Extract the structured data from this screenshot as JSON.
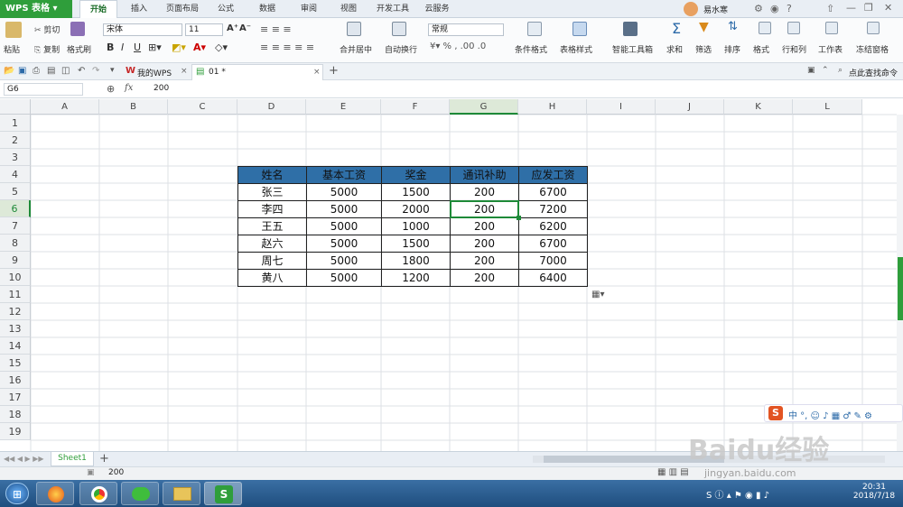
{
  "app": {
    "name": "WPS 表格"
  },
  "menu": {
    "tabs": [
      "开始",
      "插入",
      "页面布局",
      "公式",
      "数据",
      "审阅",
      "视图",
      "开发工具",
      "云服务"
    ],
    "user": "易水寒"
  },
  "ribbon": {
    "paste": "粘贴",
    "cut": "剪切",
    "copy": "复制",
    "format_painter": "格式刷",
    "font_name": "宋体",
    "font_size": "11",
    "merge_center": "合并居中",
    "wrap_text": "自动换行",
    "number_format": "常规",
    "conditional_format": "条件格式",
    "table_style": "表格样式",
    "smart_toolbox": "智能工具箱",
    "sum": "求和",
    "filter": "筛选",
    "sort": "排序",
    "format": "格式",
    "rows_cols": "行和列",
    "worksheet": "工作表",
    "freeze": "冻结窗格"
  },
  "doc_tabs": {
    "my_wps": "我的WPS",
    "file": "01 *",
    "find_command": "点此查找命令"
  },
  "formula_bar": {
    "name_box": "G6",
    "fx": "fx",
    "value": "200"
  },
  "columns": [
    "A",
    "B",
    "C",
    "D",
    "E",
    "F",
    "G",
    "H",
    "I",
    "J",
    "K",
    "L"
  ],
  "rows": [
    "1",
    "2",
    "3",
    "4",
    "5",
    "6",
    "7",
    "8",
    "9",
    "10",
    "11",
    "12",
    "13",
    "14",
    "15",
    "16",
    "17",
    "18",
    "19"
  ],
  "table": {
    "headers": [
      "姓名",
      "基本工资",
      "奖金",
      "通讯补助",
      "应发工资"
    ],
    "rows": [
      [
        "张三",
        "5000",
        "1500",
        "200",
        "6700"
      ],
      [
        "李四",
        "5000",
        "2000",
        "200",
        "7200"
      ],
      [
        "王五",
        "5000",
        "1000",
        "200",
        "6200"
      ],
      [
        "赵六",
        "5000",
        "1500",
        "200",
        "6700"
      ],
      [
        "周七",
        "5000",
        "1800",
        "200",
        "7000"
      ],
      [
        "黄八",
        "5000",
        "1200",
        "200",
        "6400"
      ]
    ]
  },
  "colors": {
    "header_fill": "#2f6fa7",
    "accent": "#2f9e3b",
    "selection": "#1e8a38"
  },
  "sheet": {
    "name": "Sheet1",
    "add": "+"
  },
  "status": {
    "value": "200",
    "watermark": "Baidu经验",
    "watermark_url": "jingyan.baidu.com"
  },
  "taskbar": {
    "time": "20:31",
    "date": "2018/7/18"
  }
}
